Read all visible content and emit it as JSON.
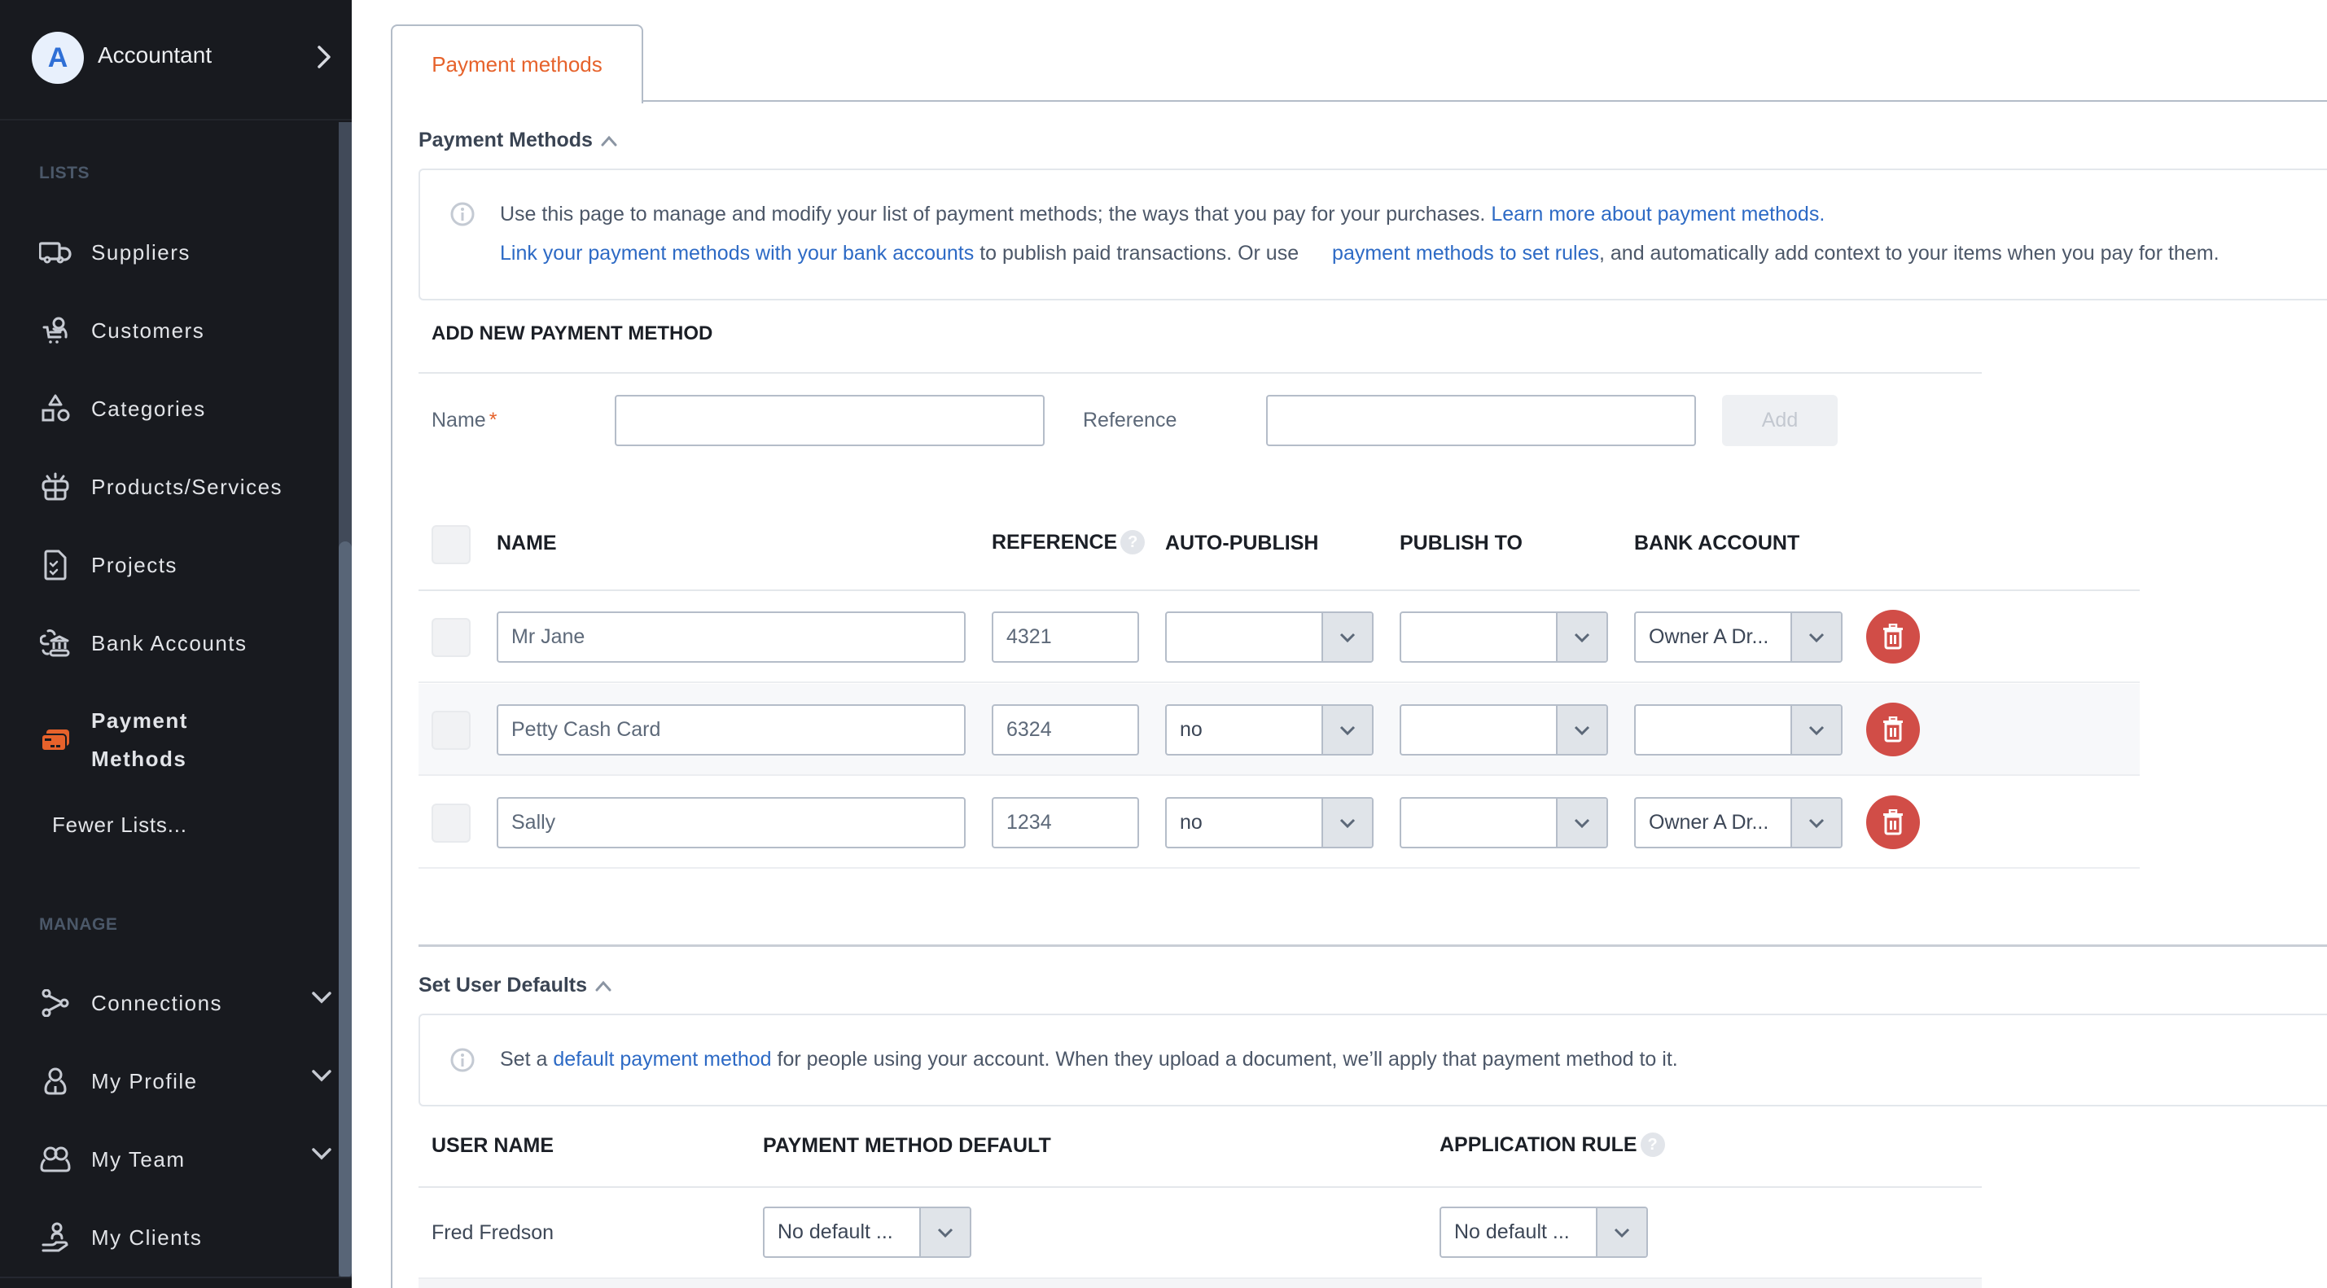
{
  "sidebar": {
    "user": {
      "initial": "A",
      "name": "Accountant"
    },
    "sections": {
      "lists": "LISTS",
      "manage": "MANAGE"
    },
    "lists_items": [
      {
        "label": "Suppliers",
        "icon": "truck-icon"
      },
      {
        "label": "Customers",
        "icon": "customer-cart-icon"
      },
      {
        "label": "Categories",
        "icon": "shapes-icon"
      },
      {
        "label": "Products/Services",
        "icon": "box-icon"
      },
      {
        "label": "Projects",
        "icon": "clipboard-check-icon"
      },
      {
        "label": "Bank Accounts",
        "icon": "bank-icon"
      },
      {
        "label": "Payment Methods",
        "icon": "credit-cards-icon",
        "active": true
      }
    ],
    "active_label_line1": "Payment",
    "active_label_line2": "Methods",
    "fewer_lists": "Fewer Lists...",
    "manage_items": [
      {
        "label": "Connections",
        "icon": "connections-icon",
        "expandable": true
      },
      {
        "label": "My Profile",
        "icon": "user-icon",
        "expandable": true
      },
      {
        "label": "My Team",
        "icon": "team-icon",
        "expandable": true
      },
      {
        "label": "My Clients",
        "icon": "client-hand-icon",
        "expandable": false
      }
    ],
    "active_color": "#E6622B"
  },
  "tabs": [
    {
      "label": "Payment methods",
      "active": true
    }
  ],
  "payment_methods_section": {
    "title": "Payment Methods",
    "info": {
      "line1_text": "Use this page to manage and modify your list of payment methods; the ways that you pay for your purchases. ",
      "line1_link": "Learn more about payment methods.",
      "line2_link1": "Link your payment methods with your bank accounts",
      "line2_text1": " to publish paid transactions. Or use ",
      "line2_link2": "payment methods to set rules",
      "line2_text2": ", and automatically add context to your items when you pay for them."
    },
    "add_form": {
      "title": "ADD NEW PAYMENT METHOD",
      "name_label": "Name",
      "required_mark": "*",
      "name_value": "",
      "reference_label": "Reference",
      "reference_value": "",
      "add_button": "Add"
    },
    "table": {
      "columns": [
        "NAME",
        "REFERENCE",
        "AUTO-PUBLISH",
        "PUBLISH TO",
        "BANK ACCOUNT"
      ],
      "help_glyph": "?",
      "rows": [
        {
          "name": "Mr Jane",
          "reference": "4321",
          "auto_publish": "",
          "publish_to": "",
          "bank_account": "Owner A Dr..."
        },
        {
          "name": "Petty Cash Card",
          "reference": "6324",
          "auto_publish": "no",
          "publish_to": "",
          "bank_account": ""
        },
        {
          "name": "Sally",
          "reference": "1234",
          "auto_publish": "no",
          "publish_to": "",
          "bank_account": "Owner A Dr..."
        }
      ]
    }
  },
  "user_defaults_section": {
    "title": "Set User Defaults",
    "info": {
      "text1": "Set a ",
      "link": "default payment method",
      "text2": " for people using your account. When they upload a document, we’ll apply that payment method to it."
    },
    "table": {
      "columns": [
        "USER NAME",
        "PAYMENT METHOD DEFAULT",
        "APPLICATION RULE"
      ],
      "rows": [
        {
          "user_name": "Fred Fredson",
          "payment_method_default": "No default ...",
          "application_rule": "No default ..."
        }
      ]
    }
  },
  "colors": {
    "accent": "#E6622B",
    "link": "#2D6AC5",
    "delete": "#D14D47",
    "sidebar_bg": "#181A1F"
  }
}
